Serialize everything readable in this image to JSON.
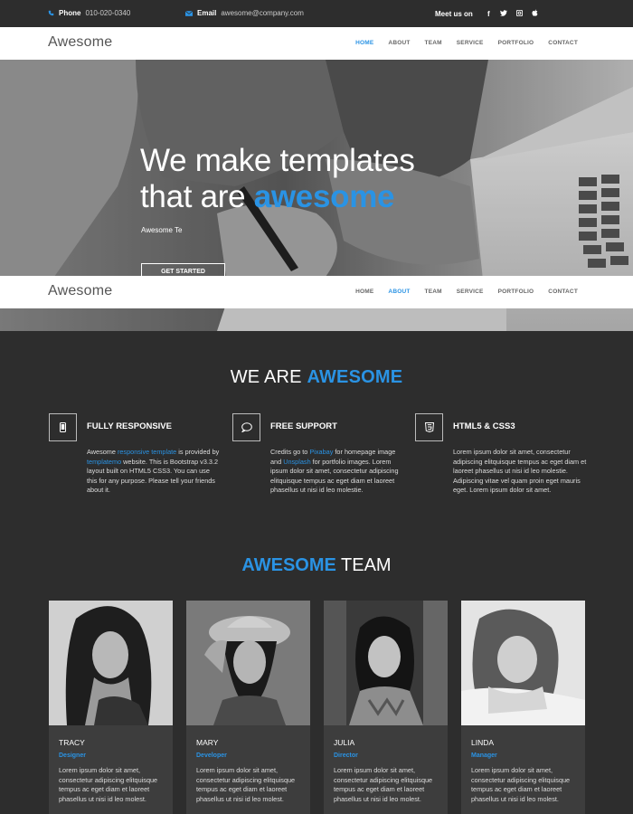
{
  "topbar": {
    "phone_label": "Phone",
    "phone_value": "010-020-0340",
    "email_label": "Email",
    "email_value": "awesome@company.com",
    "meet_label": "Meet us on",
    "social": [
      "f",
      "t",
      "ig",
      "apple"
    ]
  },
  "nav_top": {
    "logo": "Awesome",
    "items": [
      "HOME",
      "ABOUT",
      "TEAM",
      "SERVICE",
      "PORTFOLIO",
      "CONTACT"
    ],
    "active": "HOME"
  },
  "nav_sticky": {
    "logo": "Awesome",
    "items": [
      "HOME",
      "ABOUT",
      "TEAM",
      "SERVICE",
      "PORTFOLIO",
      "CONTACT"
    ],
    "active": "ABOUT"
  },
  "hero": {
    "line1": "We make templates",
    "line2_prefix": "that are ",
    "line2_highlight": "awesome",
    "subtitle": "Awesome Te",
    "button": "GET STARTED"
  },
  "about": {
    "title_prefix": "WE ARE ",
    "title_highlight": "AWESOME",
    "features": [
      {
        "icon": "mobile-icon",
        "title": "FULLY RESPONSIVE",
        "text_parts": [
          "Awesome ",
          "responsive template",
          " is provided by ",
          "templatemo",
          " website. This is Bootstrap v3.3.2 layout built on HTML5 CSS3. You can use this for any purpose. Please tell your friends about it."
        ]
      },
      {
        "icon": "chat-icon",
        "title": "FREE SUPPORT",
        "text_parts": [
          "Credits go to ",
          "Pixabay",
          " for homepage image and ",
          "Unsplash",
          " for portfolio images. Lorem ipsum dolor sit amet, consectetur adipiscing elitquisque tempus ac eget diam et laoreet phasellus ut nisi id leo molestie."
        ]
      },
      {
        "icon": "html5-icon",
        "title": "HTML5 & CSS3",
        "text_parts": [
          "Lorem ipsum dolor sit amet, consectetur adipiscing elitquisque tempus ac eget diam et laoreet phasellus ut nisi id leo molestie. Adipiscing vitae vel quam proin eget mauris eget. Lorem ipsum dolor sit amet."
        ]
      }
    ]
  },
  "team": {
    "title_highlight": "AWESOME",
    "title_suffix": " TEAM",
    "members": [
      {
        "name": "TRACY",
        "role": "Designer",
        "desc": "Lorem ipsum dolor sit amet, consectetur adipiscing elitquisque tempus ac eget diam et laoreet phasellus ut nisi id leo molest."
      },
      {
        "name": "MARY",
        "role": "Developer",
        "desc": "Lorem ipsum dolor sit amet, consectetur adipiscing elitquisque tempus ac eget diam et laoreet phasellus ut nisi id leo molest."
      },
      {
        "name": "JULIA",
        "role": "Director",
        "desc": "Lorem ipsum dolor sit amet, consectetur adipiscing elitquisque tempus ac eget diam et laoreet phasellus ut nisi id leo molest."
      },
      {
        "name": "LINDA",
        "role": "Manager",
        "desc": "Lorem ipsum dolor sit amet, consectetur adipiscing elitquisque tempus ac eget diam et laoreet phasellus ut nisi id leo molest."
      }
    ]
  },
  "colors": {
    "accent": "#2a93e4",
    "background": "#2d2d2d",
    "card": "#3d3d3d"
  }
}
